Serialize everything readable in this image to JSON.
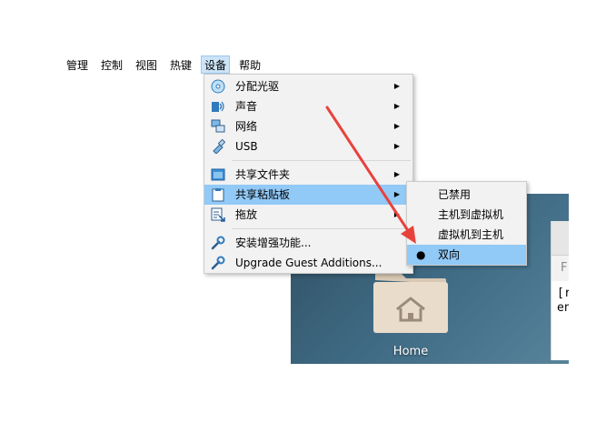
{
  "menubar": {
    "items": [
      {
        "label": "管理"
      },
      {
        "label": "控制"
      },
      {
        "label": "视图"
      },
      {
        "label": "热键"
      },
      {
        "label": "设备",
        "active": true
      },
      {
        "label": "帮助"
      }
    ]
  },
  "device_menu": {
    "items": [
      {
        "label": "分配光驱",
        "icon": "cd-drive-icon",
        "submenu": true
      },
      {
        "label": "声音",
        "icon": "audio-icon",
        "submenu": true
      },
      {
        "label": "网络",
        "icon": "network-icon",
        "submenu": true
      },
      {
        "label": "USB",
        "icon": "usb-icon",
        "submenu": true
      },
      {
        "label": "共享文件夹",
        "icon": "shared-folder-icon",
        "submenu": true
      },
      {
        "label": "共享粘贴板",
        "icon": "clipboard-icon",
        "submenu": true,
        "highlighted": true
      },
      {
        "label": "拖放",
        "icon": "drag-drop-icon",
        "submenu": true
      },
      {
        "label": "安装增强功能...",
        "icon": "install-additions-icon",
        "submenu": false
      },
      {
        "label": "Upgrade Guest Additions...",
        "icon": "upgrade-additions-icon",
        "submenu": false
      }
    ]
  },
  "clipboard_submenu": {
    "items": [
      {
        "label": "已禁用"
      },
      {
        "label": "主机到虚拟机"
      },
      {
        "label": "虚拟机到主机"
      },
      {
        "label": "双向",
        "selected": true
      }
    ]
  },
  "guest": {
    "home_label": "Home",
    "window_f": "F",
    "window_line1": "[r",
    "window_line2": "en"
  },
  "colors": {
    "highlight": "#91c9f7",
    "menu_bg": "#f2f2f2",
    "annotation_arrow": "#e8423c",
    "folder": "#e9dccb"
  }
}
